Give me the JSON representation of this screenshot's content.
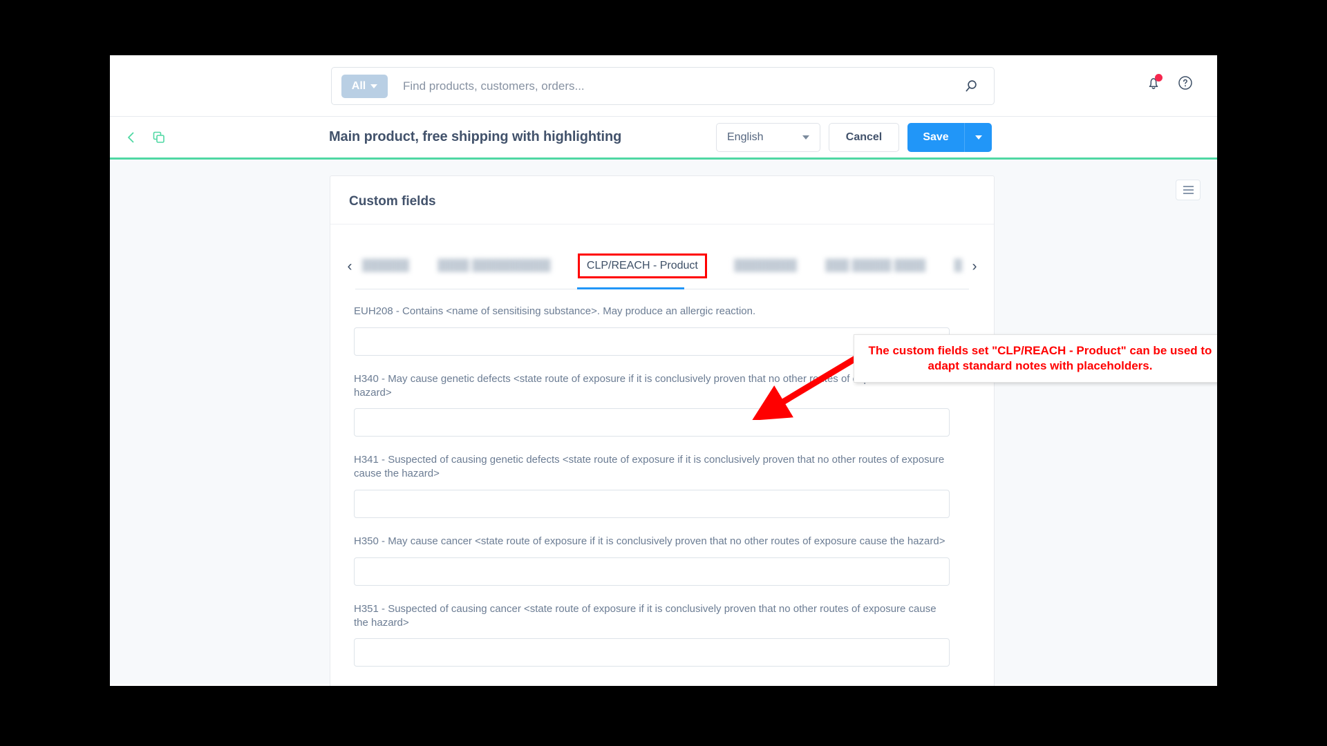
{
  "topbar": {
    "search_scope": "All",
    "search_placeholder": "Find products, customers, orders...",
    "search_value": "",
    "search_icon": "search-icon",
    "notification_icon": "bell-icon",
    "help_icon": "help-circle-icon"
  },
  "header": {
    "back_icon": "chevron-left-icon",
    "duplicate_icon": "copy-icon",
    "title": "Main product, free shipping with highlighting",
    "language": "English",
    "cancel_label": "Cancel",
    "save_label": "Save",
    "save_dropdown_icon": "chevron-down-icon"
  },
  "card": {
    "title": "Custom fields",
    "panel_toggle_icon": "list-menu-icon"
  },
  "tabs": {
    "prev_icon": "chevron-left-icon",
    "next_icon": "chevron-right-icon",
    "items": [
      {
        "label": "██████",
        "blurred": true,
        "active": false
      },
      {
        "label": "████ ██████████",
        "blurred": true,
        "active": false
      },
      {
        "label": "CLP/REACH - Product",
        "blurred": false,
        "active": true
      },
      {
        "label": "████████",
        "blurred": true,
        "active": false
      },
      {
        "label": "███ █████ ████",
        "blurred": true,
        "active": false
      },
      {
        "label": "█",
        "blurred": true,
        "active": false
      }
    ]
  },
  "fields": [
    {
      "label": "EUH208 - Contains <name of sensitising substance>. May produce an allergic reaction.",
      "value": ""
    },
    {
      "label": "H340 - May cause genetic defects <state route of exposure if it is conclusively proven that no other routes of exposure cause the hazard>",
      "value": ""
    },
    {
      "label": "H341 - Suspected of causing genetic defects <state route of exposure if it is conclusively proven that no other routes of exposure cause the hazard>",
      "value": ""
    },
    {
      "label": "H350 - May cause cancer <state route of exposure if it is conclusively proven that no other routes of exposure cause the hazard>",
      "value": ""
    },
    {
      "label": "H351 - Suspected of causing cancer <state route of exposure if it is conclusively proven that no other routes of exposure cause the hazard>",
      "value": ""
    }
  ],
  "annotation": {
    "text": "The custom fields set \"CLP/REACH - Product\" can be used to adapt standard notes with placeholders.",
    "color": "#ff0000"
  },
  "colors": {
    "accent_blue": "#2196f8",
    "accent_green": "#4fd8a3",
    "annotation_red": "#ff0000",
    "notification_red": "#f5274e"
  }
}
